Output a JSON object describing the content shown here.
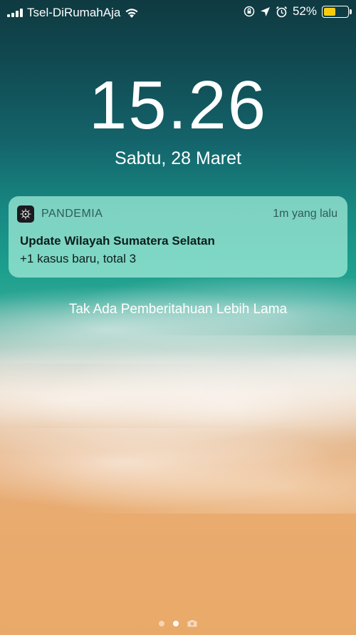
{
  "status_bar": {
    "carrier": "Tsel-DiRumahAja",
    "battery_percent_text": "52%",
    "battery_level": 0.52,
    "icons": [
      "signal-icon",
      "wifi-icon",
      "orientation-lock-icon",
      "location-icon",
      "alarm-icon",
      "battery-icon"
    ]
  },
  "lock_screen": {
    "time": "15.26",
    "date": "Sabtu, 28 Maret",
    "no_older_notifications": "Tak Ada Pemberitahuan Lebih Lama"
  },
  "notification": {
    "app_name": "PANDEMIA",
    "time_ago": "1m yang lalu",
    "title": "Update Wilayah Sumatera Selatan",
    "body": "+1 kasus baru, total 3"
  },
  "page_indicator": {
    "pages": [
      "widgets-page",
      "lock-page",
      "camera-page"
    ],
    "active": "lock-page"
  },
  "colors": {
    "battery_fill": "#f7cc10",
    "text": "#ffffff"
  }
}
